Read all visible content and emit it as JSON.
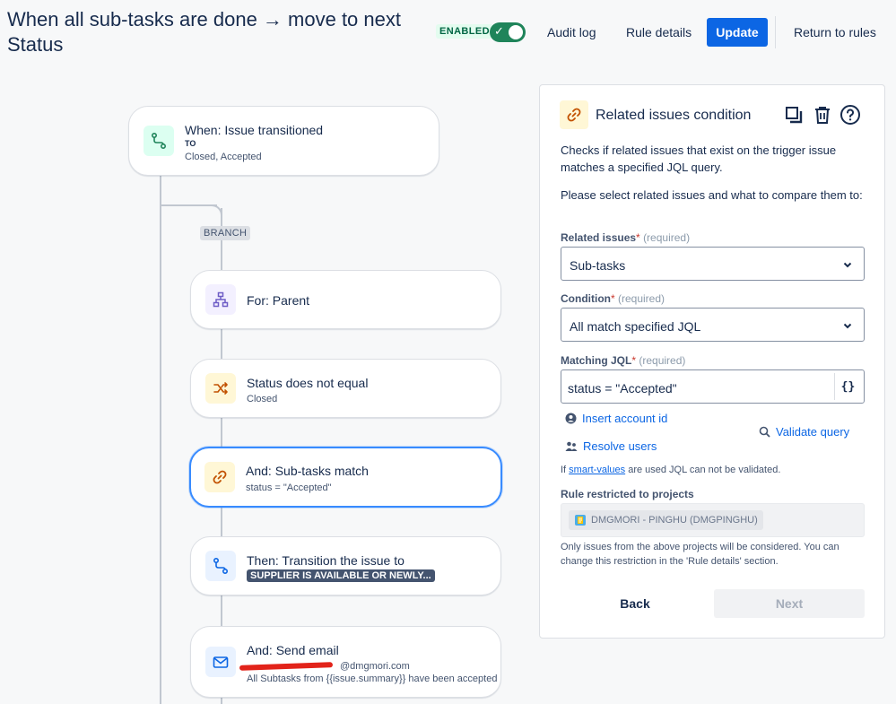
{
  "header": {
    "title": "When all sub-tasks are done → move to next Status",
    "enabled_label": "ENABLED",
    "links": {
      "audit_log": "Audit log",
      "rule_details": "Rule details",
      "update": "Update",
      "return_to_rules": "Return to rules"
    }
  },
  "flow": {
    "trigger": {
      "title": "When: Issue transitioned",
      "to_label": "TO",
      "statuses": "Closed, Accepted"
    },
    "branch_label": "BRANCH",
    "steps": [
      {
        "title": "For: Parent",
        "icon": "hierarchy-icon"
      },
      {
        "title": "Status does not equal",
        "subtitle": "Closed",
        "icon": "shuffle-icon"
      },
      {
        "title": "And: Sub-tasks match",
        "subtitle": "status = \"Accepted\"",
        "icon": "link-icon"
      },
      {
        "title": "Then: Transition the issue to",
        "status_lozenge": "SUPPLIER IS AVAILABLE OR NEWLY...",
        "icon": "transition-icon"
      },
      {
        "title": "And: Send email",
        "email_domain": "@dmgmori.com",
        "body": "All Subtasks from {{issue.summary}} have been accepted",
        "icon": "mail-icon"
      }
    ]
  },
  "panel": {
    "title": "Related issues condition",
    "description": "Checks if related issues that exist on the trigger issue matches a specified JQL query.",
    "instruction": "Please select related issues and what to compare them to:",
    "related_issues": {
      "label": "Related issues",
      "required": "*",
      "required_text": "(required)",
      "value": "Sub-tasks"
    },
    "condition": {
      "label": "Condition",
      "required": "*",
      "required_text": "(required)",
      "value": "All match specified JQL"
    },
    "matching_jql": {
      "label": "Matching JQL",
      "required": "*",
      "required_text": "(required)",
      "value": "status = \"Accepted\"",
      "smart_values_button": "{}"
    },
    "insert_account_id": "Insert account id",
    "resolve_users": "Resolve users",
    "validate_query": "Validate query",
    "smart_note": {
      "prefix": "If ",
      "link": "smart-values",
      "suffix": " are used JQL can not be validated."
    },
    "restricted": {
      "label": "Rule restricted to projects",
      "project": "DMGMORI - PINGHU (DMGPINGHU)"
    },
    "restriction_note": "Only issues from the above projects will be considered. You can change this restriction in the 'Rule details' section.",
    "back": "Back",
    "next": "Next"
  },
  "colors": {
    "primary": "#0c66e4",
    "toggle_on": "#1f845a",
    "selected_border": "#388bff",
    "redaction": "#e2231a"
  }
}
